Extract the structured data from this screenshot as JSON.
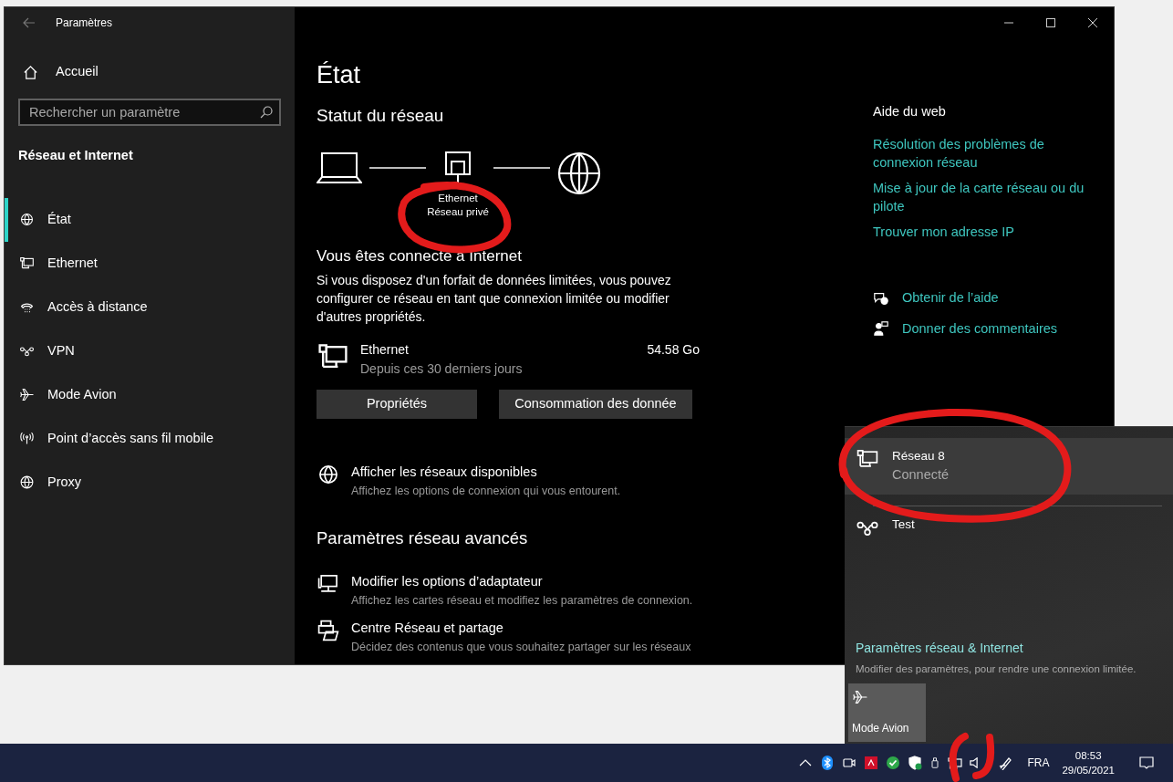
{
  "window": {
    "title": "Paramètres"
  },
  "sidebar": {
    "home": "Accueil",
    "search": {
      "placeholder": "Rechercher un paramètre"
    },
    "section": "Réseau et Internet",
    "items": [
      {
        "label": "État",
        "kind": "status",
        "selected": true
      },
      {
        "label": "Ethernet",
        "kind": "ethernet",
        "selected": false
      },
      {
        "label": "Accès à distance",
        "kind": "dialup",
        "selected": false
      },
      {
        "label": "VPN",
        "kind": "vpn",
        "selected": false
      },
      {
        "label": "Mode Avion",
        "kind": "airplane",
        "selected": false
      },
      {
        "label": "Point d’accès sans fil mobile",
        "kind": "hotspot",
        "selected": false
      },
      {
        "label": "Proxy",
        "kind": "globe",
        "selected": false
      }
    ]
  },
  "main": {
    "title": "État",
    "status_heading": "Statut du réseau",
    "diagram": {
      "adapter": "Ethernet",
      "profile": "Réseau privé"
    },
    "connected_heading": "Vous êtes connecté à Internet",
    "description": "Si vous disposez d'un forfait de données limitées, vous pouvez configurer ce réseau en tant que connexion limitée ou modifier d'autres propriétés.",
    "usage": {
      "name": "Ethernet",
      "period": "Depuis ces 30 derniers jours",
      "amount": "54.58 Go"
    },
    "buttons": [
      "Propriétés",
      "Consommation des donnée"
    ],
    "actions": [
      {
        "title": "Afficher les réseaux disponibles",
        "subtitle": "Affichez les options de connexion qui vous entourent.",
        "kind": "status"
      }
    ],
    "advanced_heading": "Paramètres réseau avancés",
    "advanced": [
      {
        "title": "Modifier les options d’adaptateur",
        "subtitle": "Affichez les cartes réseau et modifiez les paramètres de connexion.",
        "kind": "adapter"
      },
      {
        "title": "Centre Réseau et partage",
        "subtitle": "Décidez des contenus que vous souhaitez partager sur les réseaux",
        "kind": "sharing"
      }
    ]
  },
  "help": {
    "heading": "Aide du web",
    "links": [
      "Résolution des problèmes de connexion réseau",
      "Mise à jour de la carte réseau ou du pilote",
      "Trouver mon adresse IP"
    ],
    "actions": [
      {
        "label": "Obtenir de l’aide",
        "kind": "help"
      },
      {
        "label": "Donner des commentaires",
        "kind": "feedback"
      }
    ]
  },
  "flyout": {
    "networks": [
      {
        "name": "Réseau 8",
        "status": "Connecté",
        "kind": "ethernet",
        "selected": true
      },
      {
        "name": "Test",
        "kind": "vpn",
        "selected": false
      }
    ],
    "settings_link": "Paramètres réseau & Internet",
    "settings_hint": "Modifier des paramètres, pour rendre une connexion limitée.",
    "tiles": [
      {
        "label": "Mode Avion",
        "kind": "airplane",
        "on": false
      }
    ]
  },
  "taskbar": {
    "language": "FRA",
    "time": "08:53",
    "date": "29/05/2021"
  }
}
